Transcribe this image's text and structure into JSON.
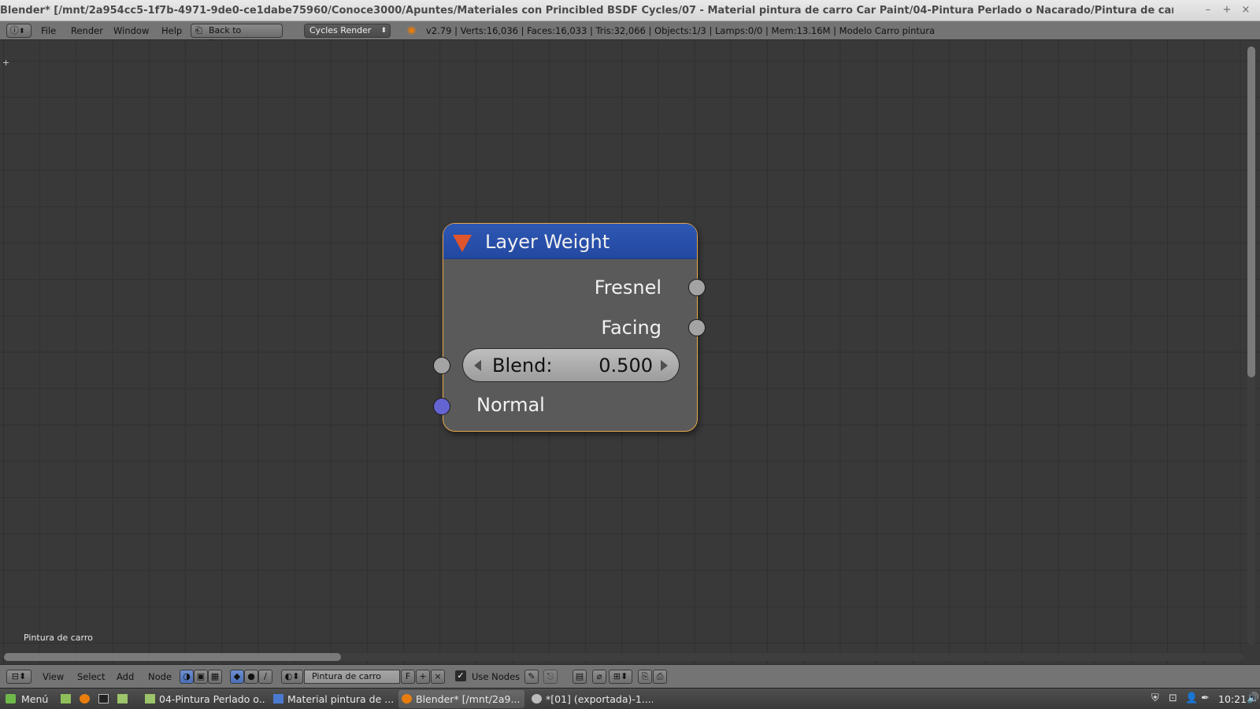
{
  "window": {
    "title": "Blender* [/mnt/2a954cc5-1f7b-4971-9de0-ce1dabe75960/Conoce3000/Apuntes/Materiales con Princibled BSDF Cycles/07 - Material pintura de carro Car Paint/04-Pintura Perlado o Nacarado/Pintura de carro.blend]",
    "minimize": "–",
    "maximize": "+",
    "close": "×"
  },
  "info_header": {
    "menus": [
      "File",
      "Render",
      "Window",
      "Help"
    ],
    "back_button": "Back to Previous",
    "render_engine": "Cycles Render",
    "stats": "v2.79 | Verts:16,036 | Faces:16,033 | Tris:32,066 | Objects:1/3 | Lamps:0/0 | Mem:13.16M | Modelo Carro pintura"
  },
  "node": {
    "title": "Layer Weight",
    "outputs": [
      "Fresnel",
      "Facing"
    ],
    "blend_label": "Blend:",
    "blend_value": "0.500",
    "input_normal": "Normal"
  },
  "editor": {
    "material_label": "Pintura de carro"
  },
  "footer": {
    "menus": [
      "View",
      "Select",
      "Add",
      "Node"
    ],
    "material_name": "Pintura de carro",
    "fake_user": "F",
    "use_nodes_label": "Use Nodes"
  },
  "taskbar": {
    "menu_label": "Menú",
    "tasks": [
      "04-Pintura Perlado o...",
      "Material pintura de ...",
      "Blender* [/mnt/2a9...",
      "*[01] (exportada)-1...."
    ],
    "clock": "10:21"
  },
  "colors": {
    "node_header": "#2e58b4",
    "node_border": "#e8a84a",
    "socket_grey": "#a3a3a3",
    "socket_vector": "#6464d2",
    "collapse_arrow": "#e0552c"
  }
}
